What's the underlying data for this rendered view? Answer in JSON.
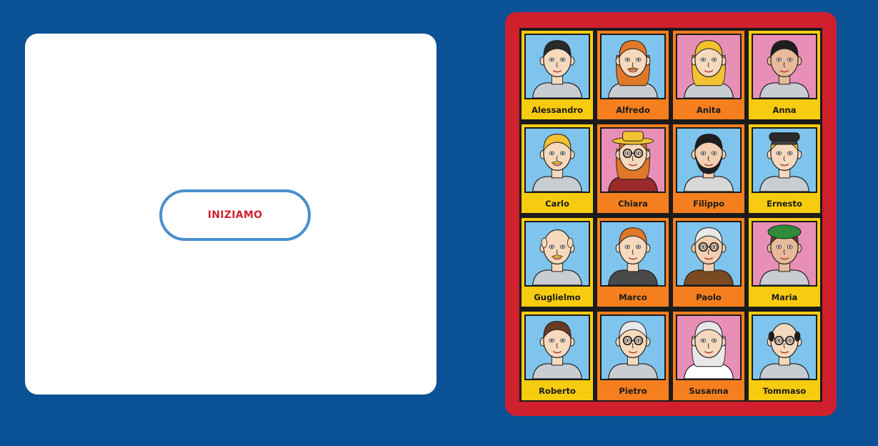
{
  "start": {
    "label": "INIZIAMO"
  },
  "colors": {
    "background": "#0a5295",
    "board": "#d0202e",
    "button_text": "#d02230",
    "button_border": "#4a8fcd",
    "card_yellow": "#f7cc10",
    "card_orange": "#f57f1e"
  },
  "characters": [
    {
      "name": "Alessandro",
      "card": "yellow",
      "bg": "#7fc4ec",
      "skin": "#f6d9bd",
      "hair": "#2a2a2a",
      "shirt": "#c9ccd1",
      "hat": ""
    },
    {
      "name": "Alfredo",
      "card": "orange",
      "bg": "#7fc4ec",
      "skin": "#f6d9bd",
      "hair": "#e0782a",
      "shirt": "#c9ccd1",
      "hat": ""
    },
    {
      "name": "Anita",
      "card": "orange",
      "bg": "#e88fb8",
      "skin": "#f6d9bd",
      "hair": "#f2c230",
      "shirt": "#c9ccd1",
      "hat": ""
    },
    {
      "name": "Anna",
      "card": "yellow",
      "bg": "#e88fb8",
      "skin": "#e8b99a",
      "hair": "#1e1e1e",
      "shirt": "#c9ccd1",
      "hat": ""
    },
    {
      "name": "Carlo",
      "card": "yellow",
      "bg": "#7fc4ec",
      "skin": "#f6d9bd",
      "hair": "#f2c230",
      "shirt": "#c9ccd1",
      "hat": ""
    },
    {
      "name": "Chiara",
      "card": "orange",
      "bg": "#e88fb8",
      "skin": "#f6d9bd",
      "hair": "#e0782a",
      "shirt": "#9a2a2a",
      "hat": "#f2c230"
    },
    {
      "name": "Filippo",
      "card": "orange",
      "bg": "#7fc4ec",
      "skin": "#f1cfb0",
      "hair": "#1e1e1e",
      "shirt": "#d8d8d8",
      "hat": ""
    },
    {
      "name": "Ernesto",
      "card": "yellow",
      "bg": "#7fc4ec",
      "skin": "#f6d9bd",
      "hair": "#f2c230",
      "shirt": "#c9ccd1",
      "hat": "#2a2a2a"
    },
    {
      "name": "Guglielmo",
      "card": "yellow",
      "bg": "#7fc4ec",
      "skin": "#f6d9bd",
      "hair": "#f6d9bd",
      "shirt": "#c9ccd1",
      "hat": ""
    },
    {
      "name": "Marco",
      "card": "orange",
      "bg": "#7fc4ec",
      "skin": "#f6d9bd",
      "hair": "#e0782a",
      "shirt": "#4a4a4a",
      "hat": ""
    },
    {
      "name": "Paolo",
      "card": "orange",
      "bg": "#7fc4ec",
      "skin": "#f1cfb0",
      "hair": "#e8e8e8",
      "shirt": "#7a4a22",
      "hat": ""
    },
    {
      "name": "Maria",
      "card": "yellow",
      "bg": "#e88fb8",
      "skin": "#e8b99a",
      "hair": "#6a3a22",
      "shirt": "#c9ccd1",
      "hat": "#2f8a3a"
    },
    {
      "name": "Roberto",
      "card": "yellow",
      "bg": "#7fc4ec",
      "skin": "#f6d9bd",
      "hair": "#6a3a22",
      "shirt": "#c9ccd1",
      "hat": ""
    },
    {
      "name": "Pietro",
      "card": "orange",
      "bg": "#7fc4ec",
      "skin": "#f6d9bd",
      "hair": "#e8e8e8",
      "shirt": "#c9ccd1",
      "hat": ""
    },
    {
      "name": "Susanna",
      "card": "orange",
      "bg": "#e88fb8",
      "skin": "#f6d9bd",
      "hair": "#e8e8e8",
      "shirt": "#ffffff",
      "hat": ""
    },
    {
      "name": "Tommaso",
      "card": "yellow",
      "bg": "#7fc4ec",
      "skin": "#f6d9bd",
      "hair": "#1e1e1e",
      "shirt": "#c9ccd1",
      "hat": ""
    }
  ]
}
